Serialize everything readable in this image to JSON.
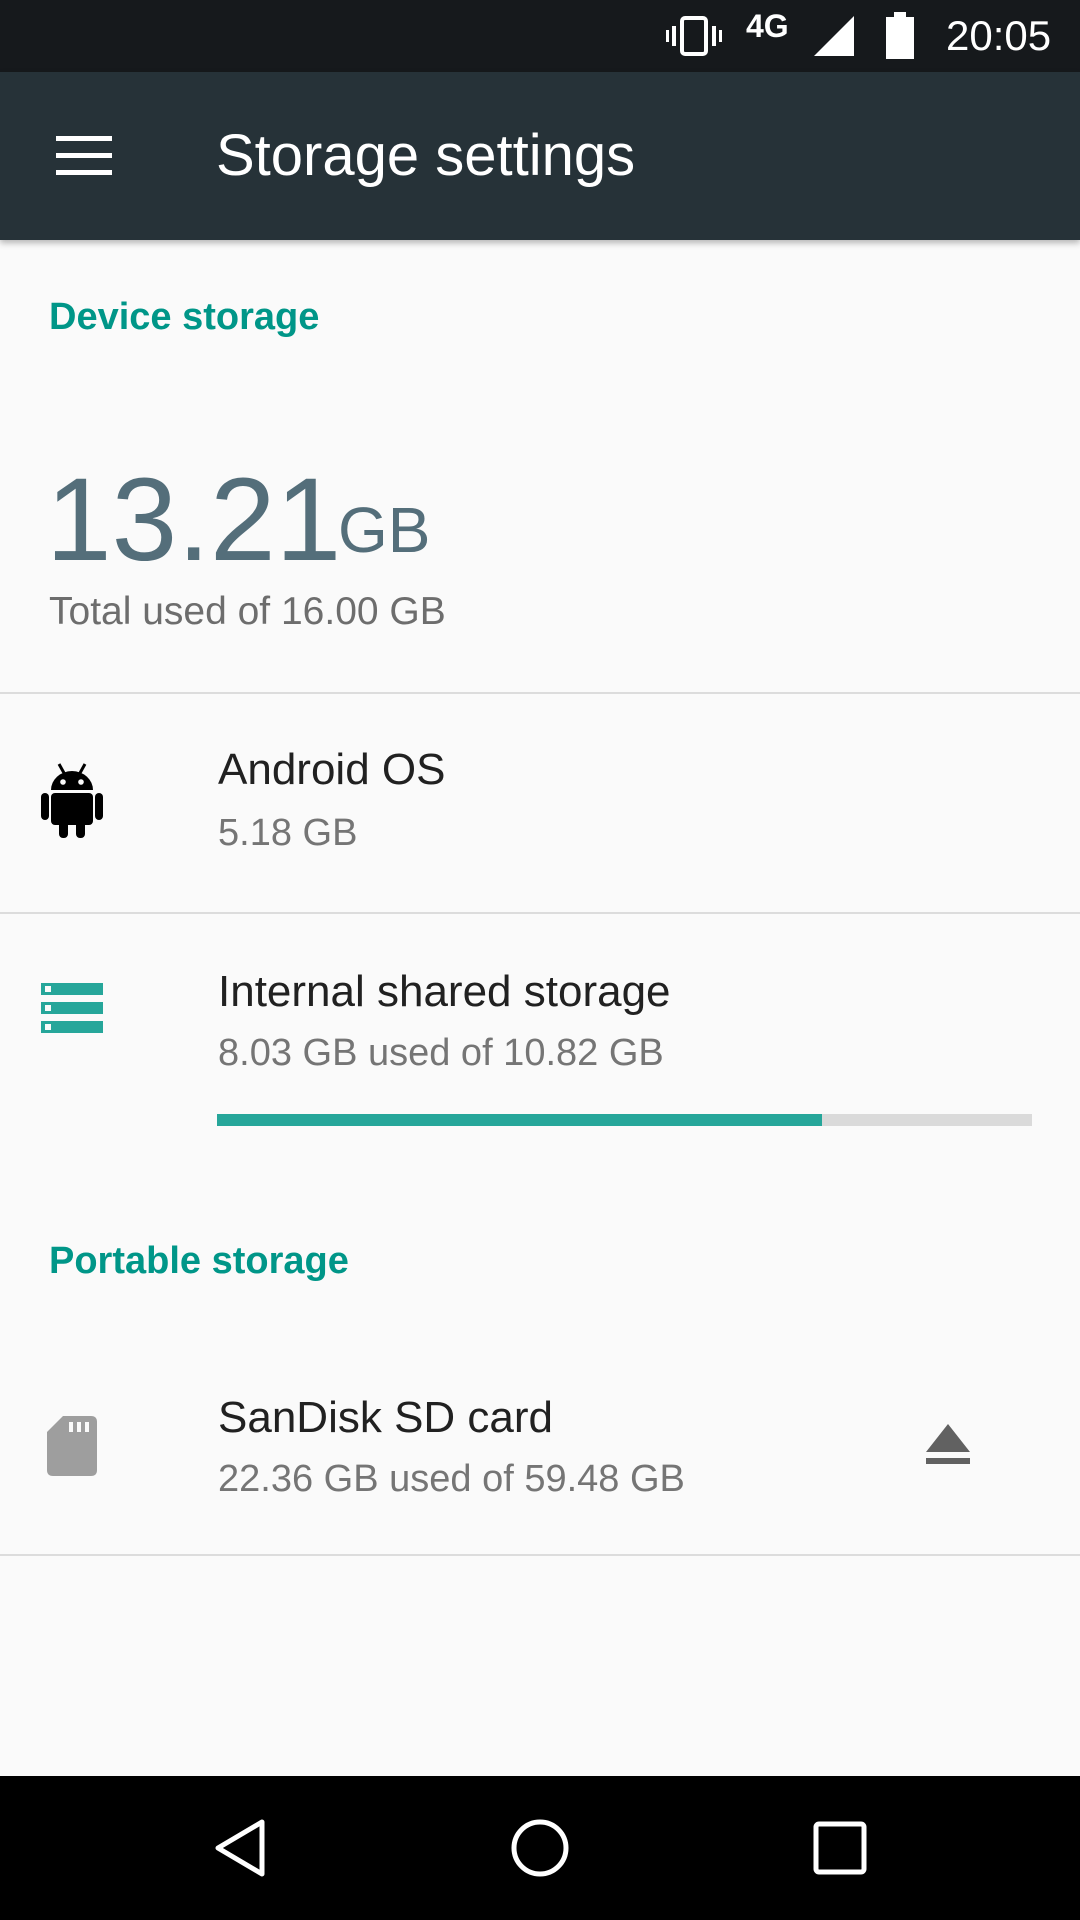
{
  "status_bar": {
    "network": "4G",
    "time": "20:05",
    "icons": [
      "vibrate-icon",
      "signal-icon",
      "battery-icon"
    ]
  },
  "app_bar": {
    "title": "Storage settings",
    "menu_icon": "hamburger-menu-icon"
  },
  "device_storage": {
    "header": "Device storage",
    "used_value": "13.21",
    "used_unit": "GB",
    "summary": "Total used of 16.00 GB"
  },
  "items": {
    "android_os": {
      "icon": "android-icon",
      "title": "Android OS",
      "subtitle": "5.18 GB"
    },
    "internal": {
      "icon": "storage-icon",
      "title": "Internal shared storage",
      "subtitle": "8.03 GB used of 10.82 GB",
      "progress_fraction": 0.742
    },
    "sdcard": {
      "icon": "sd-card-icon",
      "title": "SanDisk SD card",
      "subtitle": "22.36 GB used of 59.48 GB",
      "action_icon": "eject-icon"
    }
  },
  "portable_storage": {
    "header": "Portable storage"
  },
  "nav_bar": {
    "icons": [
      "back-icon",
      "home-icon",
      "recents-icon"
    ]
  },
  "colors": {
    "accent": "#009688",
    "progress": "#26a69a",
    "app_bar": "#263238",
    "status_bar": "#16191c",
    "summary_number": "#546e7a"
  }
}
